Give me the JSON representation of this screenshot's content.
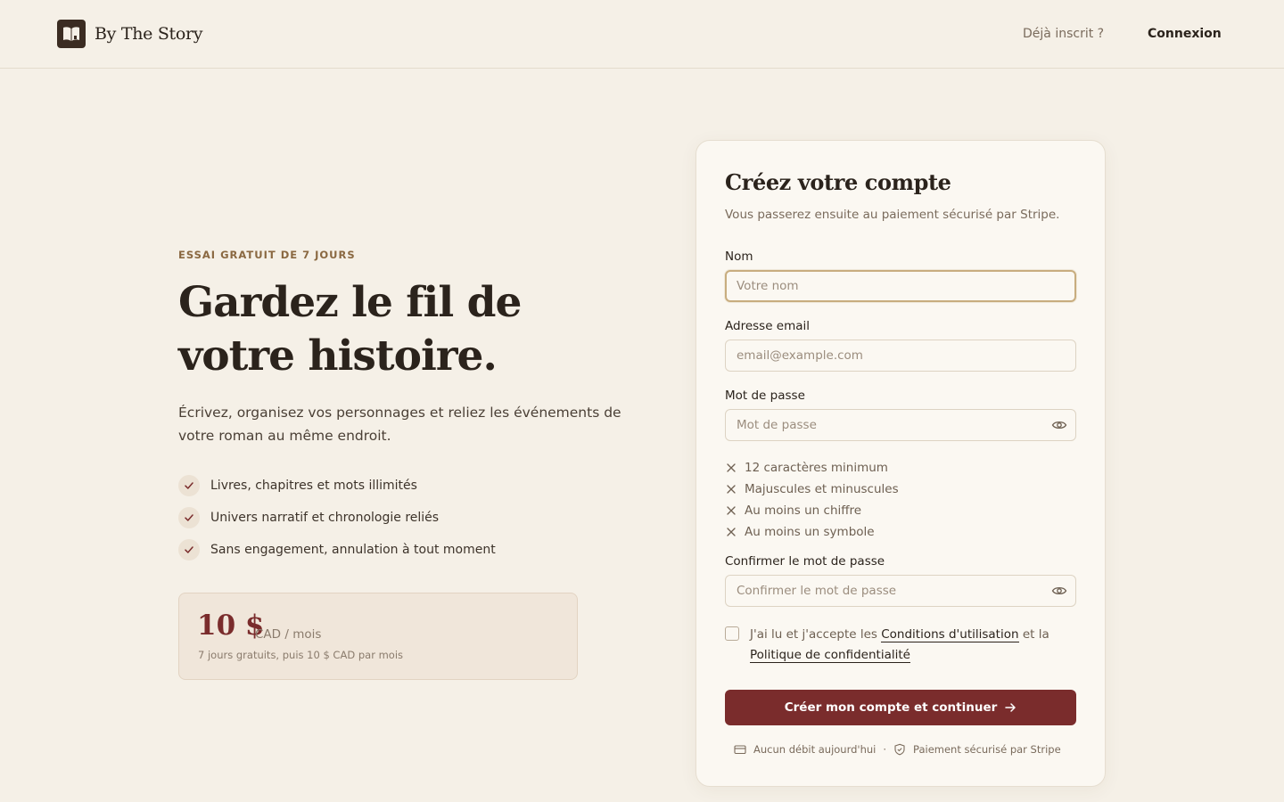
{
  "header": {
    "brand": "By The Story",
    "already_registered": "Déjà inscrit ?",
    "login": "Connexion"
  },
  "hero": {
    "eyebrow": "ESSAI GRATUIT DE 7 JOURS",
    "headline_line1": "Gardez le fil de",
    "headline_line2": "votre histoire.",
    "lead_line1": "Écrivez, organisez vos personnages et reliez les événements de",
    "lead_line2": "votre roman au même endroit.",
    "features": [
      "Livres, chapitres et mots illimités",
      "Univers narratif et chronologie reliés",
      "Sans engagement, annulation à tout moment"
    ]
  },
  "pricing": {
    "amount": "10 $",
    "unit": "CAD / mois",
    "note": "7 jours gratuits, puis 10 $ CAD par mois"
  },
  "form": {
    "title": "Créez votre compte",
    "subtitle": "Vous passerez ensuite au paiement sécurisé par Stripe.",
    "name_label": "Nom",
    "name_placeholder": "Votre nom",
    "email_label": "Adresse email",
    "email_placeholder": "email@example.com",
    "password_label": "Mot de passe",
    "password_placeholder": "Mot de passe",
    "password_rules": [
      "12 caractères minimum",
      "Majuscules et minuscules",
      "Au moins un chiffre",
      "Au moins un symbole"
    ],
    "confirm_label": "Confirmer le mot de passe",
    "confirm_placeholder": "Confirmer le mot de passe",
    "terms_prefix": "J'ai lu et j'accepte les",
    "terms_link": "Conditions d'utilisation",
    "terms_mid": "et la",
    "privacy_link": "Politique de confidentialité",
    "submit": "Créer mon compte et continuer",
    "trust_no_charge": "Aucun débit aujourd'hui",
    "trust_separator": "·",
    "trust_secure": "Paiement sécurisé par Stripe"
  },
  "colors": {
    "background": "#f5f0e7",
    "accent": "#7a2c2c",
    "eyebrow": "#8a6841",
    "focus_border": "#c8ad7f"
  }
}
